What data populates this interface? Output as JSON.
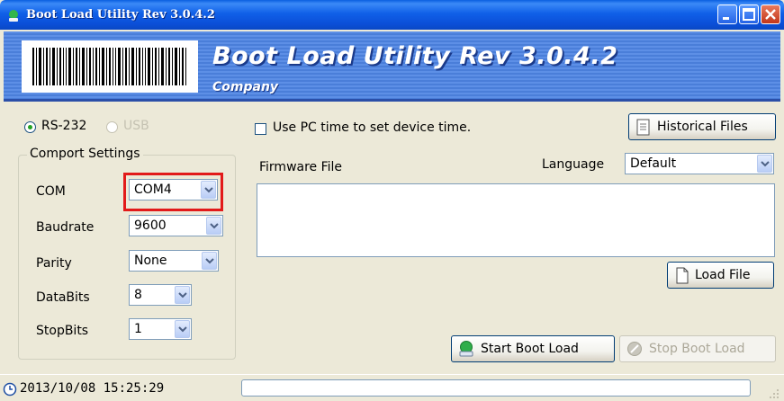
{
  "window": {
    "title": "Boot Load Utility Rev 3.0.4.2"
  },
  "banner": {
    "title": "Boot Load Utility Rev 3.0.4.2",
    "subtitle": "Company"
  },
  "interface": {
    "rs232_label": "RS-232",
    "usb_label": "USB",
    "selected": "RS-232"
  },
  "comport": {
    "legend": "Comport Settings",
    "com_label": "COM",
    "com_value": "COM4",
    "baudrate_label": "Baudrate",
    "baudrate_value": "9600",
    "parity_label": "Parity",
    "parity_value": "None",
    "databits_label": "DataBits",
    "databits_value": "8",
    "stopbits_label": "StopBits",
    "stopbits_value": "1"
  },
  "options": {
    "use_pc_time_label": "Use PC time to set device time.",
    "use_pc_time_checked": false
  },
  "buttons": {
    "historical_files": "Historical Files",
    "load_file": "Load File",
    "start_boot_load": "Start Boot Load",
    "stop_boot_load": "Stop Boot Load"
  },
  "firmware": {
    "label": "Firmware File",
    "path": ""
  },
  "language": {
    "label": "Language",
    "value": "Default"
  },
  "status": {
    "datetime": "2013/10/08  15:25:29",
    "progress": 0
  },
  "colors": {
    "highlight_border": "#e21a1a",
    "titlebar": "#0b4fd8",
    "banner": "#5d8fe6"
  }
}
